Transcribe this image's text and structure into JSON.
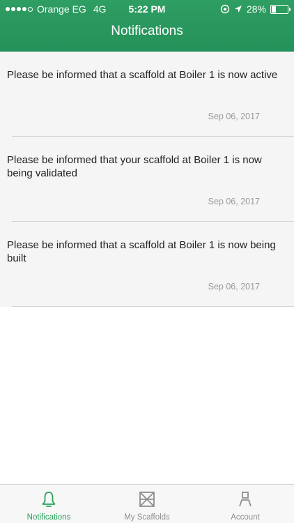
{
  "status_bar": {
    "carrier": "Orange EG",
    "network": "4G",
    "time": "5:22 PM",
    "battery_percent": "28%",
    "battery_level": 0.28,
    "signal_bars": 4
  },
  "header": {
    "title": "Notifications",
    "color": "#2b9a5e"
  },
  "notifications": [
    {
      "message": "Please be informed that a scaffold at Boiler 1 is now active",
      "date": "Sep 06, 2017"
    },
    {
      "message": "Please be informed that your scaffold at Boiler 1 is now being validated",
      "date": "Sep 06, 2017"
    },
    {
      "message": "Please be informed that a scaffold at Boiler 1 is now being built",
      "date": "Sep 06, 2017"
    }
  ],
  "tab_bar": {
    "items": [
      {
        "label": "Notifications",
        "icon": "bell-icon",
        "active": true
      },
      {
        "label": "My Scaffolds",
        "icon": "scaffold-icon",
        "active": false
      },
      {
        "label": "Account",
        "icon": "account-icon",
        "active": false
      }
    ],
    "active_color": "#2aa15c"
  }
}
